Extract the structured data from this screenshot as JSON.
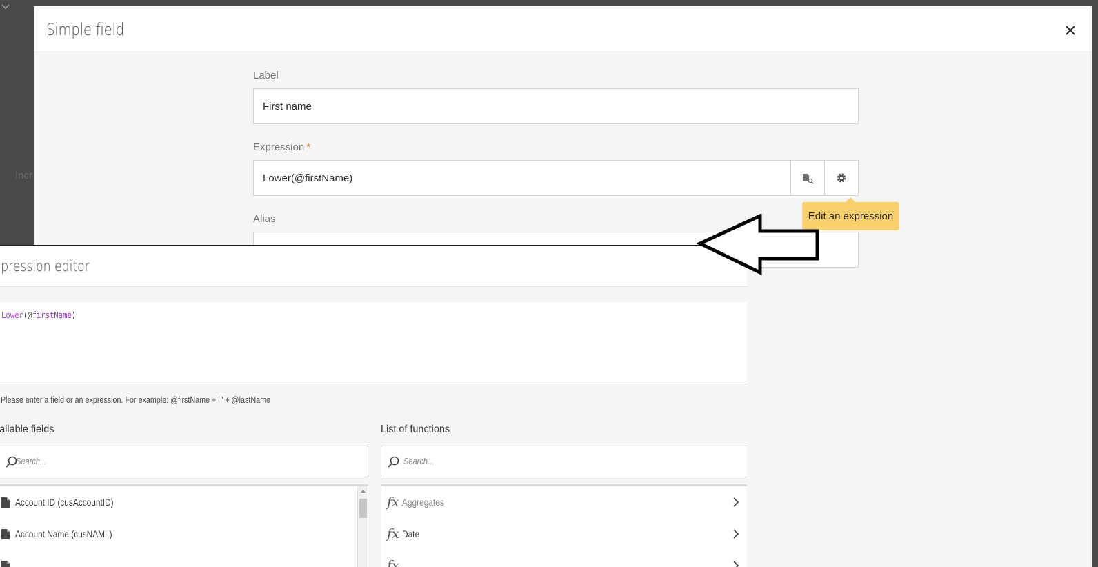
{
  "background": {
    "partial_text": "Incr"
  },
  "dialog": {
    "title": "Simple field",
    "label_field": {
      "label": "Label",
      "value": "First name"
    },
    "expression_field": {
      "label": "Expression",
      "required_marker": "*",
      "value": "Lower(@firstName)"
    },
    "alias_field": {
      "label": "Alias",
      "value": ""
    },
    "tooltip": "Edit an expression"
  },
  "expression_editor": {
    "title": "xpression editor",
    "code": {
      "function": "Lower",
      "open": "(@",
      "field": "firstName",
      "close": ")"
    },
    "hint": "Please enter a field or an expression. For example: @firstName + ' ' + @lastName",
    "available_fields": {
      "title": "vailable fields",
      "search_placeholder": "Search...",
      "items": [
        {
          "label": "Account ID (cusAccountID)"
        },
        {
          "label": "Account Name (cusNAML)"
        }
      ]
    },
    "functions": {
      "title": "List of functions",
      "search_placeholder": "Search...",
      "items": [
        {
          "label": "Aggregates"
        },
        {
          "label": "Date"
        }
      ]
    }
  },
  "colors": {
    "tooltip": "#f7cf6b",
    "required": "#e68619",
    "code_function": "#b23cdc"
  }
}
